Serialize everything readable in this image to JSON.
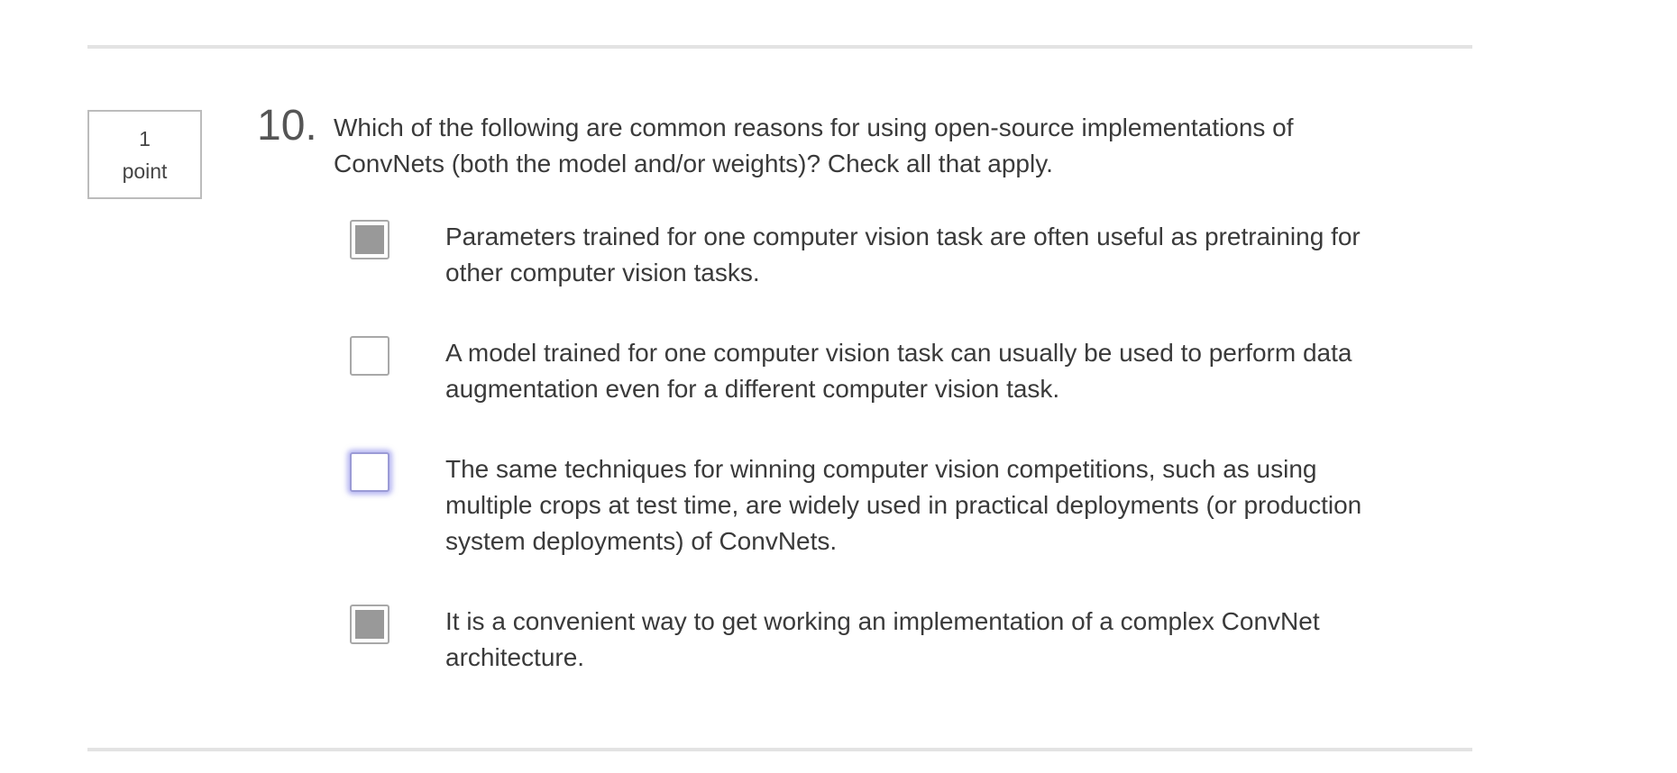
{
  "question": {
    "points_value": "1",
    "points_unit": "point",
    "number": "10.",
    "text": "Which of the following are common reasons for using open-source implementations of ConvNets (both the model and/or weights)? Check all that apply."
  },
  "options": [
    {
      "label": "Parameters trained for one computer vision task are often useful as pretraining for other computer vision tasks.",
      "checked": true,
      "focused": false
    },
    {
      "label": "A model trained for one computer vision task can usually be used to perform data augmentation even for a different computer vision task.",
      "checked": false,
      "focused": false
    },
    {
      "label": "The same techniques for winning computer vision competitions, such as using multiple crops at test time, are widely used in practical deployments (or production system deployments) of ConvNets.",
      "checked": false,
      "focused": true
    },
    {
      "label": "It is a convenient way to get working an implementation of a complex ConvNet architecture.",
      "checked": true,
      "focused": false
    }
  ],
  "colors": {
    "checked_fill": "#999999",
    "focus_ring": "#7878e6",
    "divider": "#e3e3e3"
  }
}
